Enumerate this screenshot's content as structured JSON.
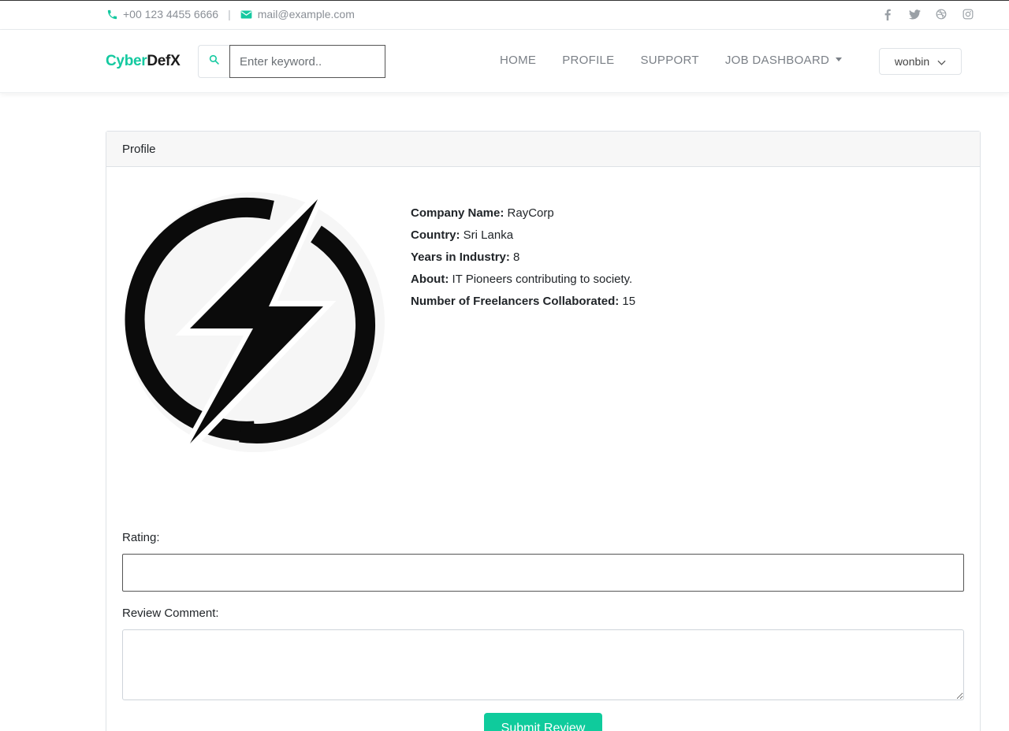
{
  "topbar": {
    "phone": "+00 123 4455 6666",
    "separator": "|",
    "email": "mail@example.com",
    "social": [
      "facebook-icon",
      "twitter-icon",
      "dribbble-icon",
      "instagram-icon"
    ]
  },
  "brand": {
    "part1": "Cyber",
    "part2": "DefX",
    "accent_color": "#14c9a0"
  },
  "search": {
    "placeholder": "Enter keyword.."
  },
  "nav": {
    "home": "HOME",
    "profile": "PROFILE",
    "support": "SUPPORT",
    "job_dashboard": "JOB DASHBOARD"
  },
  "user": {
    "name": "wonbin"
  },
  "profile_card": {
    "header": "Profile",
    "logo_icon": "lightning-bolt-logo",
    "fields": {
      "company_label": "Company Name:",
      "company_value": "RayCorp",
      "country_label": "Country:",
      "country_value": "Sri Lanka",
      "years_label": "Years in Industry:",
      "years_value": "8",
      "about_label": "About:",
      "about_value": "IT Pioneers contributing to society.",
      "freelancers_label": "Number of Freelancers Collaborated:",
      "freelancers_value": "15"
    }
  },
  "review_form": {
    "rating_label": "Rating:",
    "rating_value": "",
    "comment_label": "Review Comment:",
    "comment_value": "",
    "submit_label": "Submit Review",
    "submit_color": "#0fcb9c"
  }
}
